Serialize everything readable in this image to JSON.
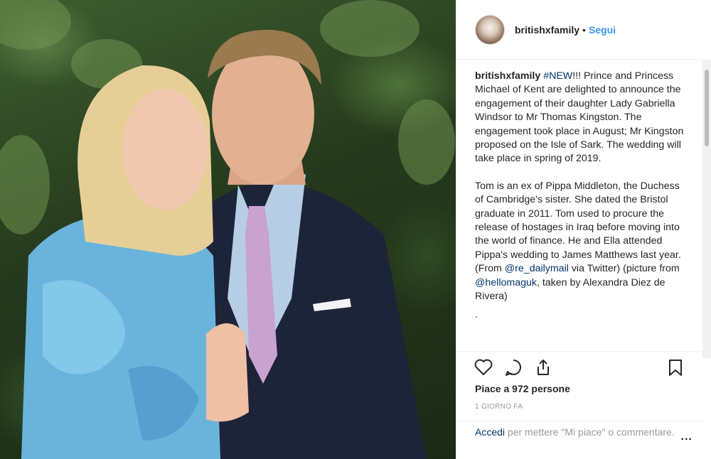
{
  "post": {
    "username": "britishxfamily",
    "separator": "•",
    "follow_label": "Segui"
  },
  "caption": {
    "username": "britishxfamily",
    "hashtag": "#NEW",
    "para1_rest": "!!! Prince and Princess Michael of Kent are delighted to announce the engagement of their daughter Lady Gabriella Windsor to Mr Thomas Kingston. The engagement took place in August; Mr Kingston proposed on the Isle of Sark. The wedding will take place in spring of 2019.",
    "para2_a": "Tom is an ex of Pippa Middleton, the Duchess of Cambridge's sister. She dated the Bristol graduate in 2011. Tom used to procure the release of hostages in Iraq before moving into the world of finance. He and Ella attended Pippa's wedding to James Matthews last year. (From ",
    "mention1": "@re_dailymail",
    "para2_b": " via Twitter) (picture from ",
    "mention2": "@hellomaguk",
    "para2_c": ", taken by Alexandra Diez de Rivera)",
    "tail": "."
  },
  "actions": {
    "like_icon": "heart-icon",
    "comment_icon": "comment-icon",
    "share_icon": "share-icon",
    "save_icon": "bookmark-icon"
  },
  "likes_text": "Piace a 972 persone",
  "time_text": "1 GIORNO FA",
  "comment_box": {
    "login_label": "Accedi",
    "rest_text": " per mettere \"Mi piace\" o commentare.",
    "more_label": "..."
  }
}
